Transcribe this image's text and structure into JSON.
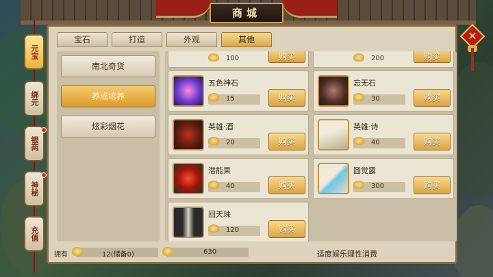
{
  "title": "商城",
  "side_tabs": [
    "元宝",
    "绑元",
    "银两",
    "神秘",
    "充值"
  ],
  "tabs": [
    "宝石",
    "打造",
    "外观",
    "其他"
  ],
  "active_tab": 3,
  "categories": [
    "南北奇货",
    "养成培养",
    "炫彩烟花"
  ],
  "active_category": 1,
  "items": [
    {
      "name": "",
      "price": "100",
      "buy": "购买"
    },
    {
      "name": "",
      "price": "200",
      "buy": "购买"
    },
    {
      "name": "五色神石",
      "price": "15",
      "buy": "购买"
    },
    {
      "name": "忘无石",
      "price": "30",
      "buy": "购买"
    },
    {
      "name": "英雄·酒",
      "price": "20",
      "buy": "购买"
    },
    {
      "name": "英雄·诗",
      "price": "40",
      "buy": "购买"
    },
    {
      "name": "潜能果",
      "price": "40",
      "buy": "购买"
    },
    {
      "name": "圆觉露",
      "price": "300",
      "buy": "购买"
    },
    {
      "name": "回天珠",
      "price": "120",
      "buy": "购买"
    }
  ],
  "footer": {
    "own_label": "拥有",
    "ingot_value": "12(储备0)",
    "locked_value": "630",
    "note": "适度娱乐理性消费"
  },
  "colors": {
    "accent": "#db9a2f",
    "panel": "#dcd3bd",
    "close": "#b61e14"
  }
}
